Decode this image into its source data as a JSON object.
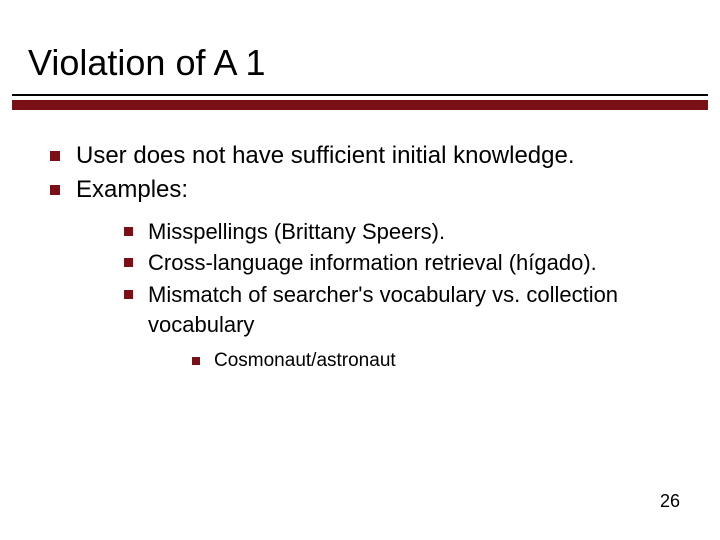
{
  "title": "Violation of A 1",
  "bullets": {
    "l1a": "User does not have sufficient initial knowledge.",
    "l1b": "Examples:",
    "l2a": "Misspellings (Brittany Speers).",
    "l2b": "Cross-language information retrieval (hígado).",
    "l2c": "Mismatch of searcher's vocabulary vs. collection vocabulary",
    "l3a": "Cosmonaut/astronaut"
  },
  "page_number": "26",
  "accent_color": "#7a1015"
}
